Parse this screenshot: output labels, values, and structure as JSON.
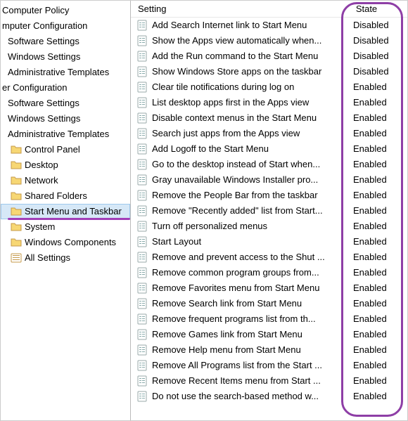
{
  "tree": {
    "root0": "Computer Policy",
    "root1": "mputer Configuration",
    "item_sw": "Software Settings",
    "item_win": "Windows Settings",
    "item_adm": "Administrative Templates",
    "root2": "er Configuration",
    "folders": [
      "Control Panel",
      "Desktop",
      "Network",
      "Shared Folders",
      "Start Menu and Taskbar",
      "System",
      "Windows Components"
    ],
    "all_settings": "All Settings"
  },
  "columns": {
    "setting": "Setting",
    "state": "State"
  },
  "policies": [
    {
      "name": "Add Search Internet link to Start Menu",
      "state": "Disabled"
    },
    {
      "name": "Show the Apps view automatically when...",
      "state": "Disabled"
    },
    {
      "name": "Add the Run command to the Start Menu",
      "state": "Disabled"
    },
    {
      "name": "Show Windows Store apps on the taskbar",
      "state": "Disabled"
    },
    {
      "name": "Clear tile notifications during log on",
      "state": "Enabled"
    },
    {
      "name": "List desktop apps first in the Apps view",
      "state": "Enabled"
    },
    {
      "name": "Disable context menus in the Start Menu",
      "state": "Enabled"
    },
    {
      "name": "Search just apps from the Apps view",
      "state": "Enabled"
    },
    {
      "name": "Add Logoff to the Start Menu",
      "state": "Enabled"
    },
    {
      "name": "Go to the desktop instead of Start when...",
      "state": "Enabled"
    },
    {
      "name": "Gray unavailable Windows Installer pro...",
      "state": "Enabled"
    },
    {
      "name": "Remove the People Bar from the taskbar",
      "state": "Enabled"
    },
    {
      "name": "Remove \"Recently added\" list from Start...",
      "state": "Enabled"
    },
    {
      "name": "Turn off personalized menus",
      "state": "Enabled"
    },
    {
      "name": "Start Layout",
      "state": "Enabled"
    },
    {
      "name": "Remove and prevent access to the Shut ...",
      "state": "Enabled"
    },
    {
      "name": "Remove common program groups from...",
      "state": "Enabled"
    },
    {
      "name": "Remove Favorites menu from Start Menu",
      "state": "Enabled"
    },
    {
      "name": "Remove Search link from Start Menu",
      "state": "Enabled"
    },
    {
      "name": "Remove frequent programs list from th...",
      "state": "Enabled"
    },
    {
      "name": "Remove Games link from Start Menu",
      "state": "Enabled"
    },
    {
      "name": "Remove Help menu from Start Menu",
      "state": "Enabled"
    },
    {
      "name": "Remove All Programs list from the Start ...",
      "state": "Enabled"
    },
    {
      "name": "Remove Recent Items menu from Start ...",
      "state": "Enabled"
    },
    {
      "name": "Do not use the search-based method w...",
      "state": "Enabled"
    }
  ]
}
